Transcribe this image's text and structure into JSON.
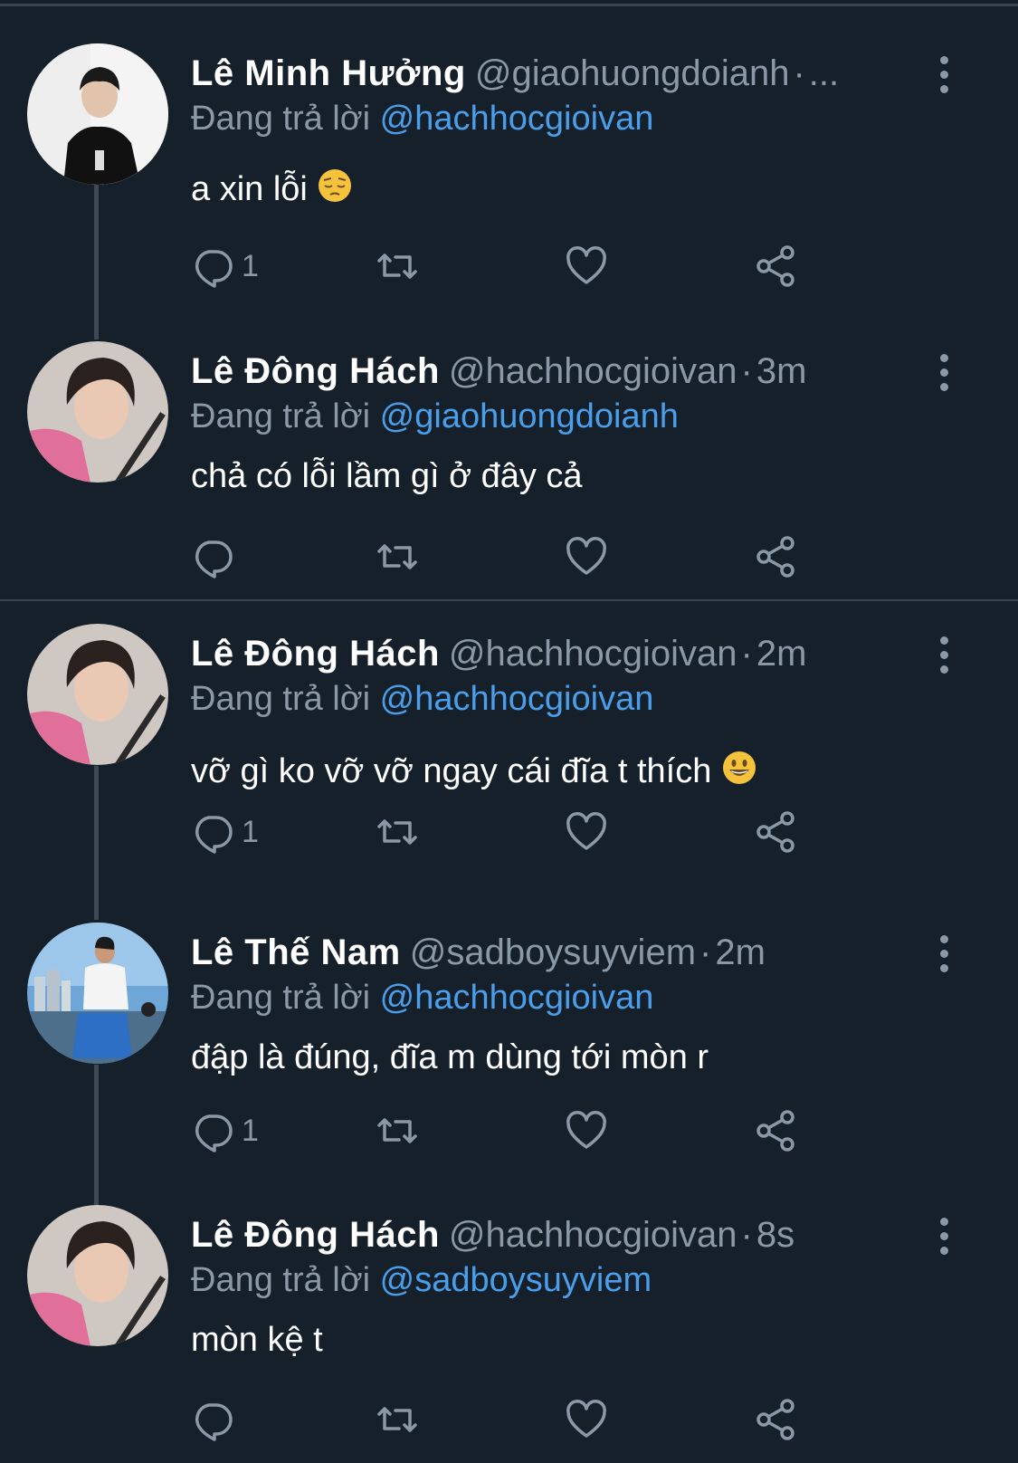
{
  "tweets": [
    {
      "name": "Lê Minh Hưởng",
      "handle": "@giaohuongdoianh",
      "dot": "·",
      "time": "...",
      "reply_prefix": "Đang trả lời",
      "reply_to": "@hachhocgioivan",
      "text": "a xin lỗi",
      "emoji": "pensive-face",
      "reply_count": "1"
    },
    {
      "name": "Lê Đông Hách",
      "handle": "@hachhocgioivan",
      "dot": "·",
      "time": "3m",
      "reply_prefix": "Đang trả lời",
      "reply_to": "@giaohuongdoianh",
      "text": "chả có lỗi lầm gì ở đây cả",
      "reply_count": ""
    },
    {
      "name": "Lê Đông Hách",
      "handle": "@hachhocgioivan",
      "dot": "·",
      "time": "2m",
      "reply_prefix": "Đang trả lời",
      "reply_to": "@hachhocgioivan",
      "text": "vỡ gì ko vỡ vỡ ngay cái đĩa t thích",
      "emoji": "smiling-face",
      "reply_count": "1"
    },
    {
      "name": "Lê Thế Nam",
      "handle": "@sadboysuyviem",
      "dot": "·",
      "time": "2m",
      "reply_prefix": "Đang trả lời",
      "reply_to": "@hachhocgioivan",
      "text": "đập là đúng, đĩa m dùng tới mòn r",
      "reply_count": "1"
    },
    {
      "name": "Lê Đông Hách",
      "handle": "@hachhocgioivan",
      "dot": "·",
      "time": "8s",
      "reply_prefix": "Đang trả lời",
      "reply_to": "@sadboysuyviem",
      "text": "mòn kệ t",
      "reply_count": ""
    }
  ],
  "icons": {
    "reply": "reply-icon",
    "retweet": "retweet-icon",
    "like": "heart-icon",
    "share": "share-icon",
    "more": "more-vertical-icon"
  },
  "colors": {
    "background": "#15202b",
    "secondary_text": "#8b98a5",
    "mention": "#4a9eea",
    "thread_line": "#3d4a55"
  }
}
